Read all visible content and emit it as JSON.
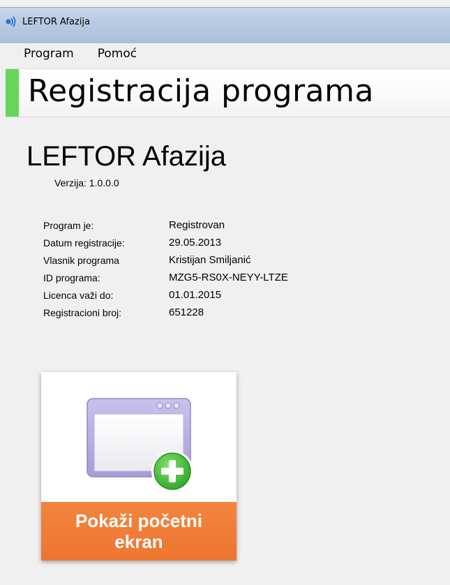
{
  "window": {
    "title": "LEFTOR Afazija"
  },
  "menu": {
    "items": [
      "Program",
      "Pomoć"
    ]
  },
  "banner": {
    "title": "Registracija programa",
    "accent_color": "#66d65a"
  },
  "product": {
    "name": "LEFTOR Afazija",
    "version": "Verzija: 1.0.0.0"
  },
  "info": {
    "rows": [
      {
        "label": "Program je:",
        "value": "Registrovan"
      },
      {
        "label": "Datum registracije:",
        "value": "29.05.2013"
      },
      {
        "label": "Vlasnik programa",
        "value": "Kristijan Smiljanić"
      },
      {
        "label": "ID programa:",
        "value": "MZG5-RS0X-NEYY-LTZE"
      },
      {
        "label": "Licenca važi do:",
        "value": "01.01.2015"
      },
      {
        "label": "Registracioni broj:",
        "value": "651228"
      }
    ]
  },
  "tile": {
    "label": "Pokaži početni ekran",
    "icon": "window-add-icon",
    "color": "#ee7530"
  }
}
